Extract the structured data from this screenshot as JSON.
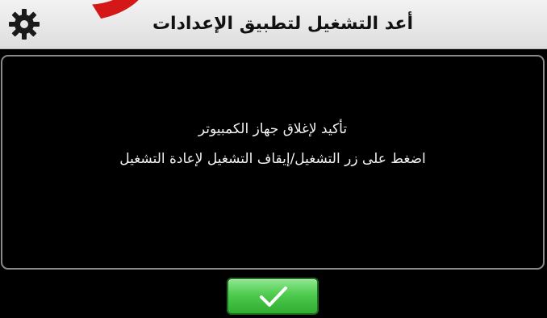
{
  "titlebar": {
    "title": "أعد التشغيل لتطبيق الإعدادات",
    "settings_icon": "gear-icon",
    "background": "#e8e8e8"
  },
  "watermark": {
    "text": "SO",
    "color": "#d20000"
  },
  "dialog": {
    "line1": "تأكيد لإغلاق جهاز الكمبيوتر",
    "line2": "اضغط على زر التشغيل/إيقاف التشغيل لإعادة التشغيل"
  },
  "confirm_button": {
    "icon": "checkmark-icon",
    "color": "#3fbf3f"
  }
}
